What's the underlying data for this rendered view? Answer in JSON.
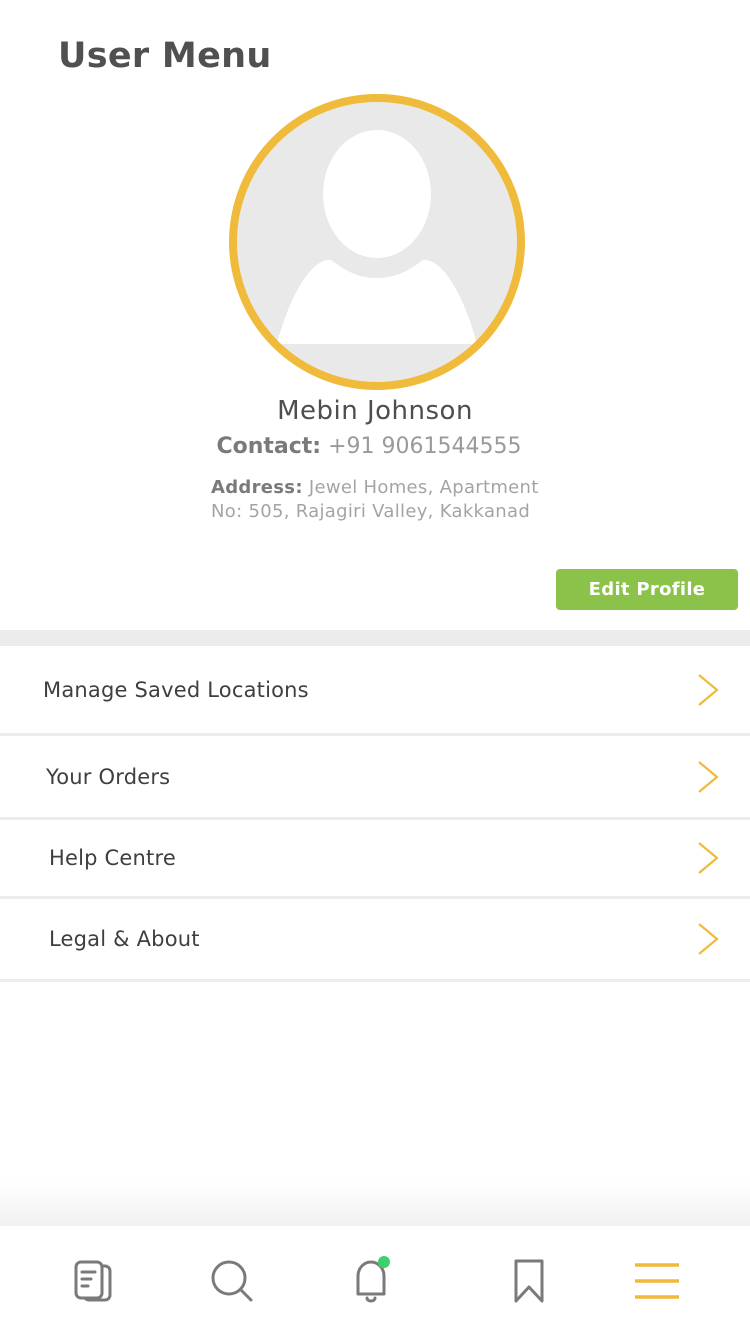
{
  "page": {
    "title": "User Menu"
  },
  "profile": {
    "name": "Mebin Johnson",
    "contact_label": "Contact:",
    "contact_value": "+91 9061544555",
    "address_label": "Address:",
    "address_value": "Jewel Homes, Apartment No: 505, Rajagiri Valley, Kakkanad",
    "avatar_icon": "user-placeholder-icon",
    "edit_button": "Edit Profile"
  },
  "menu": [
    {
      "label": "Manage Saved Locations",
      "icon": "chevron-right-icon"
    },
    {
      "label": "Your Orders",
      "icon": "chevron-right-icon"
    },
    {
      "label": "Help Centre",
      "icon": "chevron-right-icon"
    },
    {
      "label": "Legal & About",
      "icon": "chevron-right-icon"
    }
  ],
  "bottom_nav": [
    {
      "icon": "documents-icon",
      "active": false
    },
    {
      "icon": "search-icon",
      "active": false
    },
    {
      "icon": "bell-icon",
      "active": false,
      "badge_color": "#3ecf6e"
    },
    {
      "icon": "bookmark-icon",
      "active": false
    },
    {
      "icon": "menu-icon",
      "active": true
    }
  ],
  "colors": {
    "accent": "#f0ba3a",
    "edit_button": "#8bc34a",
    "icon_inactive": "#7a7a7a",
    "notification_dot": "#3ecf6e"
  }
}
